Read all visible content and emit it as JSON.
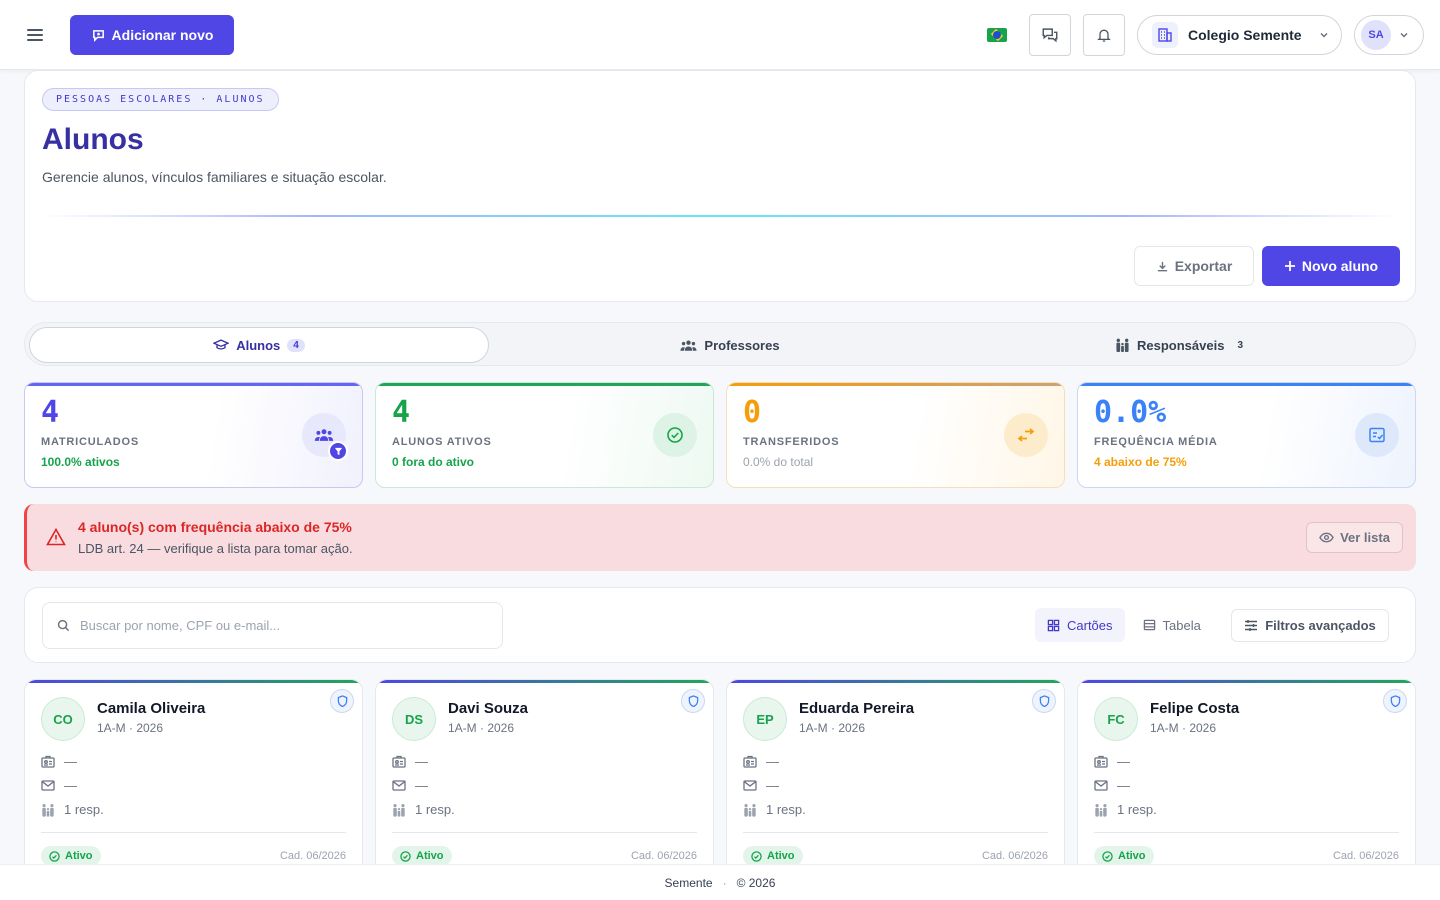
{
  "topbar": {
    "add_new_label": "Adicionar novo",
    "school_name": "Colegio Semente",
    "user_initials": "SA"
  },
  "header": {
    "breadcrumb": "PESSOAS ESCOLARES · ALUNOS",
    "title": "Alunos",
    "subtitle": "Gerencie alunos, vínculos familiares e situação escolar.",
    "export_label": "Exportar",
    "new_student_label": "Novo aluno"
  },
  "tabs": [
    {
      "label": "Alunos",
      "count": "4",
      "active": true
    },
    {
      "label": "Professores",
      "count": "",
      "active": false
    },
    {
      "label": "Responsáveis",
      "count": "3",
      "active": false
    }
  ],
  "stats": [
    {
      "value": "4",
      "label": "MATRICULADOS",
      "sub": "100.0% ativos",
      "color": "#4f46e5",
      "sub_color": "#16a34a"
    },
    {
      "value": "4",
      "label": "ALUNOS ATIVOS",
      "sub": "0 fora do ativo",
      "color": "#16a34a",
      "sub_color": "#16a34a"
    },
    {
      "value": "0",
      "label": "TRANSFERIDOS",
      "sub": "0.0% do total",
      "color": "#f59e0b",
      "sub_color": "#9ca3af"
    },
    {
      "value": "0.0%",
      "label": "FREQUÊNCIA MÉDIA",
      "sub": "4 abaixo de 75%",
      "color": "#3b82f6",
      "sub_color": "#f59e0b"
    }
  ],
  "alert": {
    "title": "4 aluno(s) com frequência abaixo de 75%",
    "text": "LDB art. 24 — verifique a lista para tomar ação.",
    "action_label": "Ver lista"
  },
  "search": {
    "placeholder": "Buscar por nome, CPF ou e-mail...",
    "view_cards_label": "Cartões",
    "view_table_label": "Tabela",
    "filters_label": "Filtros avançados"
  },
  "students": [
    {
      "initials": "CO",
      "name": "Camila Oliveira",
      "class": "1A-M · 2026",
      "id_value": "—",
      "email_value": "—",
      "guardians": "1 resp.",
      "status": "Ativo",
      "registered": "Cad. 06/2026"
    },
    {
      "initials": "DS",
      "name": "Davi Souza",
      "class": "1A-M · 2026",
      "id_value": "—",
      "email_value": "—",
      "guardians": "1 resp.",
      "status": "Ativo",
      "registered": "Cad. 06/2026"
    },
    {
      "initials": "EP",
      "name": "Eduarda Pereira",
      "class": "1A-M · 2026",
      "id_value": "—",
      "email_value": "—",
      "guardians": "1 resp.",
      "status": "Ativo",
      "registered": "Cad. 06/2026"
    },
    {
      "initials": "FC",
      "name": "Felipe Costa",
      "class": "1A-M · 2026",
      "id_value": "—",
      "email_value": "—",
      "guardians": "1 resp.",
      "status": "Ativo",
      "registered": "Cad. 06/2026"
    }
  ],
  "footer": {
    "brand": "Semente",
    "copyright": "© 2026"
  }
}
